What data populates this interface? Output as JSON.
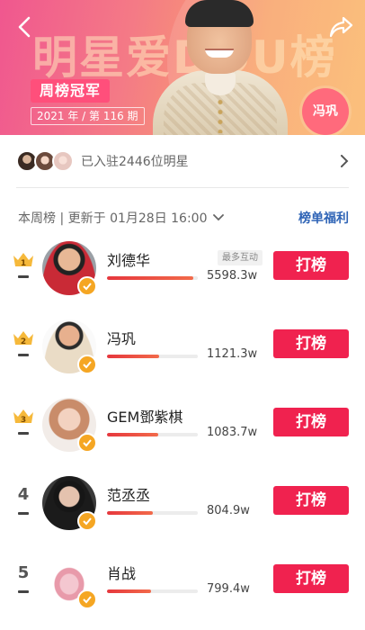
{
  "banner": {
    "title": "明星爱DOU榜",
    "badge": "周榜冠军",
    "issue": "2021 年 / 第 116 期",
    "champion_name": "冯巩"
  },
  "joined": {
    "text": "已入驻2446位明星"
  },
  "filter": {
    "label": "本周榜 | 更新于 01月28日 16:00",
    "benefits": "榜单福利"
  },
  "list": [
    {
      "rank": "1",
      "name": "刘德华",
      "tag": "最多互动",
      "score": "5598.3w",
      "progress": 0.95,
      "vote_label": "打榜"
    },
    {
      "rank": "2",
      "name": "冯巩",
      "tag": "",
      "score": "1121.3w",
      "progress": 0.57,
      "vote_label": "打榜"
    },
    {
      "rank": "3",
      "name": "GEM鄧紫棋",
      "tag": "",
      "score": "1083.7w",
      "progress": 0.56,
      "vote_label": "打榜"
    },
    {
      "rank": "4",
      "name": "范丞丞",
      "tag": "",
      "score": "804.9w",
      "progress": 0.5,
      "vote_label": "打榜"
    },
    {
      "rank": "5",
      "name": "肖战",
      "tag": "",
      "score": "799.4w",
      "progress": 0.49,
      "vote_label": "打榜"
    }
  ],
  "colors": {
    "vote_button": "#f0224f",
    "accent_link": "#2f64b6",
    "crown_gold": "#f6b93b",
    "verify_badge": "#f5a623"
  }
}
